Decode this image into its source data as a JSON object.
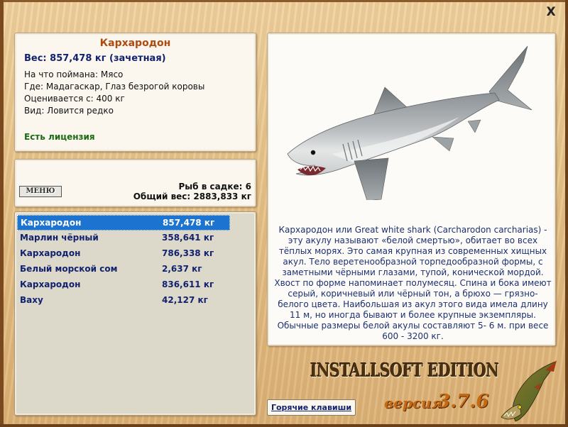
{
  "window": {
    "close_label": "X"
  },
  "info": {
    "title": "Кархародон",
    "weight_line": "Вес: 857,478 кг (зачетная)",
    "caught_on": "На что поймана: Мясо",
    "location": "Где: Мадагаскар, Глаз безрогой коровы",
    "rated_from": "Оценивается с: 400 кг",
    "kind": "Вид: Ловится редко",
    "license": "Есть лицензия"
  },
  "summary": {
    "menu_label": "МЕНЮ",
    "count": "Рыб в садке: 6",
    "total_weight": "Общий вес: 2883,833 кг"
  },
  "catch": [
    {
      "name": "Кархародон",
      "weight": "857,478 кг",
      "selected": true
    },
    {
      "name": "Марлин чёрный",
      "weight": "358,641 кг",
      "selected": false
    },
    {
      "name": "Кархародон",
      "weight": "786,338 кг",
      "selected": false
    },
    {
      "name": "Белый морской сом",
      "weight": "2,637 кг",
      "selected": false
    },
    {
      "name": "Кархародон",
      "weight": "836,611 кг",
      "selected": false
    },
    {
      "name": "Ваху",
      "weight": "42,127 кг",
      "selected": false
    }
  ],
  "description": "Кархародон или Great white shark (Carcharodon carcharias) - эту акулу называют «белой смертью», обитает во всех тёплых морях. Это самая крупная из современных хищных акул. Тело веретенообразной торпедообразной формы, с заметными чёрными глазами, тупой, конической мордой. Хвост по форме напоминает полумесяц. Спина и бока имеют серый, коричневый или чёрный тон, а брюхо — грязно-белого цвета. Наибольшая из акул этого вида имела длину 11 м, но иногда бывают и более крупные экземпляры. Обычные размеры белой акулы составляют 5- 6 м. при весе 600 - 3200 кг.",
  "footer": {
    "hotkeys_label": "Горячие клавиши",
    "edition": "INSTALLSOFT EDITION",
    "version_label": "версия",
    "version_number": "3.7.6"
  },
  "colors": {
    "title": "#b04a10",
    "text_blue": "#12226e",
    "license_green": "#1b6b14",
    "selection": "#1d74d0"
  }
}
